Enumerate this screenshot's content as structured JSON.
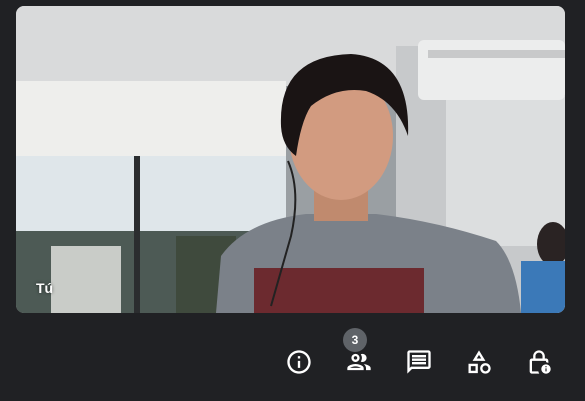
{
  "video": {
    "self_label": "Tú"
  },
  "controls": {
    "items": [
      {
        "icon": "info-icon"
      },
      {
        "icon": "people-icon",
        "badge": "3"
      },
      {
        "icon": "chat-icon"
      },
      {
        "icon": "activities-icon"
      },
      {
        "icon": "host-controls-icon"
      }
    ]
  },
  "colors": {
    "background": "#202124",
    "badge": "#5f6368",
    "icon": "#ffffff"
  }
}
